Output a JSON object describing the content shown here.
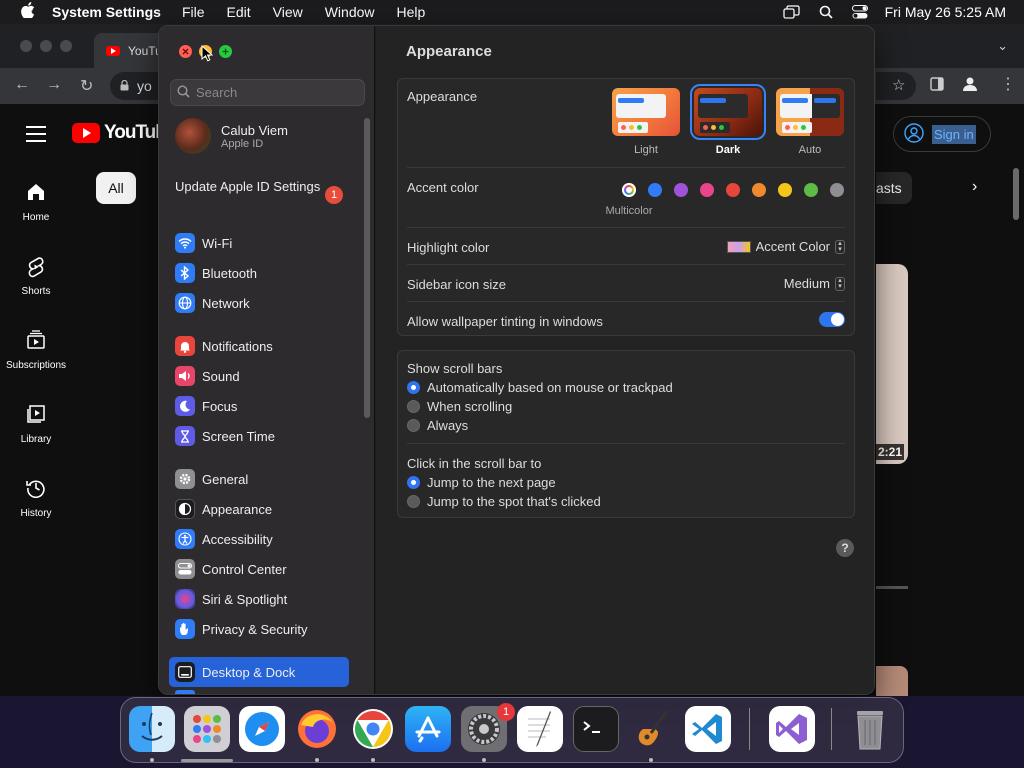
{
  "menubar": {
    "app_name": "System Settings",
    "menus": [
      "File",
      "Edit",
      "View",
      "Window",
      "Help"
    ],
    "datetime": "Fri May 26  5:25 AM"
  },
  "browser": {
    "tab_title": "YouTu",
    "url_partial": "yo",
    "logo_text": "YouTube",
    "nav": [
      "Home",
      "Shorts",
      "Subscriptions",
      "Library",
      "History"
    ],
    "chip_all": "All",
    "chip_right": "asts",
    "signin": "Sign in",
    "duration": "2:21"
  },
  "settings": {
    "search_placeholder": "Search",
    "user_name": "Calub Viem",
    "user_sub": "Apple ID",
    "update_label": "Update Apple ID Settings",
    "update_badge": "1",
    "sidebar": [
      {
        "label": "Wi-Fi",
        "icon": "wifi-icon",
        "color": "#2f7cf6"
      },
      {
        "label": "Bluetooth",
        "icon": "bluetooth-icon",
        "color": "#2f7cf6"
      },
      {
        "label": "Network",
        "icon": "globe-icon",
        "color": "#2f7cf6"
      },
      {
        "label": "Notifications",
        "icon": "bell-icon",
        "color": "#e8453c"
      },
      {
        "label": "Sound",
        "icon": "speaker-icon",
        "color": "#e8456a"
      },
      {
        "label": "Focus",
        "icon": "moon-icon",
        "color": "#5e5ce6"
      },
      {
        "label": "Screen Time",
        "icon": "hourglass-icon",
        "color": "#5e5ce6"
      },
      {
        "label": "General",
        "icon": "gear-icon",
        "color": "#8e8e93"
      },
      {
        "label": "Appearance",
        "icon": "appearance-icon",
        "color": "#1c1c1e"
      },
      {
        "label": "Accessibility",
        "icon": "accessibility-icon",
        "color": "#2f7cf6"
      },
      {
        "label": "Control Center",
        "icon": "control-center-icon",
        "color": "#8e8e93"
      },
      {
        "label": "Siri & Spotlight",
        "icon": "siri-icon",
        "color": "#a052d9"
      },
      {
        "label": "Privacy & Security",
        "icon": "hand-icon",
        "color": "#2f7cf6"
      },
      {
        "label": "Desktop & Dock",
        "icon": "desktop-icon",
        "color": "#1c1c1e"
      }
    ],
    "content": {
      "title": "Appearance",
      "appearance_label": "Appearance",
      "options": [
        "Light",
        "Dark",
        "Auto"
      ],
      "selected_option": "Dark",
      "accent_label": "Accent color",
      "accent_colors": [
        "multicolor",
        "#2f7cf6",
        "#a052d9",
        "#e8458a",
        "#e8453c",
        "#f0892d",
        "#f5c518",
        "#5dbb46",
        "#8e8e93"
      ],
      "accent_caption": "Multicolor",
      "highlight_label": "Highlight color",
      "highlight_value": "Accent Color",
      "sidebar_size_label": "Sidebar icon size",
      "sidebar_size_value": "Medium",
      "tinting_label": "Allow wallpaper tinting in windows",
      "tinting_on": true,
      "scroll_label": "Show scroll bars",
      "scroll_options": [
        "Automatically based on mouse or trackpad",
        "When scrolling",
        "Always"
      ],
      "scroll_selected": "Automatically based on mouse or trackpad",
      "click_label": "Click in the scroll bar to",
      "click_options": [
        "Jump to the next page",
        "Jump to the spot that's clicked"
      ],
      "click_selected": "Jump to the next page",
      "help": "?"
    }
  },
  "dock": {
    "apps": [
      "Finder",
      "Launchpad",
      "Safari",
      "Firefox",
      "Chrome",
      "App Store",
      "System Settings",
      "TextEdit",
      "Terminal",
      "GarageBand",
      "Visual Studio Code",
      "Visual Studio",
      "Trash"
    ],
    "badge": "1"
  }
}
